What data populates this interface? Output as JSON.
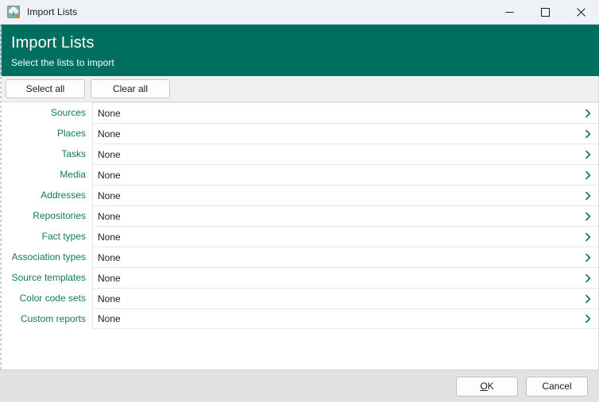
{
  "window": {
    "titlebar": {
      "title": "Import Lists",
      "app_icon": "tree-icon",
      "minimize_label": "Minimize",
      "maximize_label": "Maximize",
      "close_label": "Close"
    },
    "banner": {
      "title": "Import Lists",
      "subtitle": "Select the lists to import",
      "background_color": "#006f5f"
    },
    "toolbar": {
      "select_all_label": "Select all",
      "clear_all_label": "Clear all"
    },
    "list": {
      "accent_color": "#107860",
      "chevron_icon": "chevron-right-icon",
      "rows": [
        {
          "label": "Sources",
          "value": "None"
        },
        {
          "label": "Places",
          "value": "None"
        },
        {
          "label": "Tasks",
          "value": "None"
        },
        {
          "label": "Media",
          "value": "None"
        },
        {
          "label": "Addresses",
          "value": "None"
        },
        {
          "label": "Repositories",
          "value": "None"
        },
        {
          "label": "Fact types",
          "value": "None"
        },
        {
          "label": "Association types",
          "value": "None"
        },
        {
          "label": "Source templates",
          "value": "None"
        },
        {
          "label": "Color code sets",
          "value": "None"
        },
        {
          "label": "Custom reports",
          "value": "None"
        }
      ]
    },
    "footer": {
      "ok_accel": "O",
      "ok_rest": "K",
      "cancel_label": "Cancel"
    }
  }
}
